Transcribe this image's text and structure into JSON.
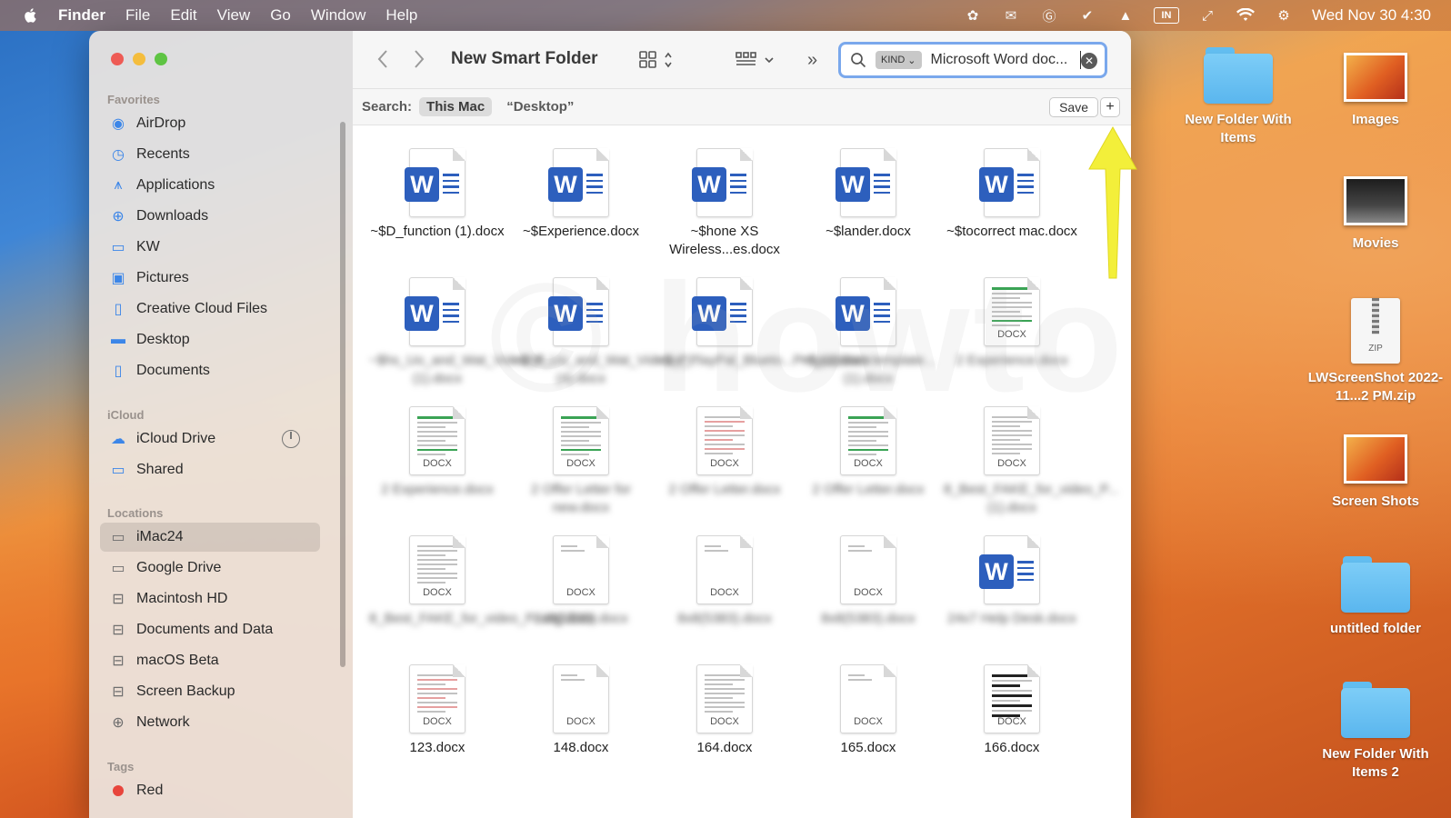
{
  "menubar": {
    "app": "Finder",
    "items": [
      "File",
      "Edit",
      "View",
      "Go",
      "Window",
      "Help"
    ],
    "input_badge": "IN",
    "clock": "Wed Nov 30  4:30"
  },
  "desktop": {
    "items": [
      {
        "label": "New Folder With Items",
        "type": "folder"
      },
      {
        "label": "Images",
        "type": "photo"
      },
      {
        "label": "Movies",
        "type": "photo-dark"
      },
      {
        "label": "LWScreenShot 2022-11...2 PM.zip",
        "type": "zip"
      },
      {
        "label": "Screen Shots",
        "type": "photo"
      },
      {
        "label": "untitled folder",
        "type": "folder"
      },
      {
        "label": "New Folder With Items 2",
        "type": "folder"
      }
    ],
    "zip_tag": "ZIP"
  },
  "sidebar": {
    "sections": {
      "favorites": "Favorites",
      "icloud": "iCloud",
      "locations": "Locations",
      "tags": "Tags"
    },
    "favorites": [
      {
        "label": "AirDrop",
        "icon": "airdrop-icon"
      },
      {
        "label": "Recents",
        "icon": "clock-icon"
      },
      {
        "label": "Applications",
        "icon": "applications-icon"
      },
      {
        "label": "Downloads",
        "icon": "download-icon"
      },
      {
        "label": "KW",
        "icon": "folder-icon"
      },
      {
        "label": "Pictures",
        "icon": "pictures-icon"
      },
      {
        "label": "Creative Cloud Files",
        "icon": "document-icon"
      },
      {
        "label": "Desktop",
        "icon": "desktop-icon"
      },
      {
        "label": "Documents",
        "icon": "document-icon"
      }
    ],
    "icloud": [
      {
        "label": "iCloud Drive",
        "icon": "cloud-icon"
      },
      {
        "label": "Shared",
        "icon": "shared-folder-icon"
      }
    ],
    "locations": [
      {
        "label": "iMac24",
        "icon": "computer-icon",
        "selected": true
      },
      {
        "label": "Google Drive",
        "icon": "folder-icon"
      },
      {
        "label": "Macintosh HD",
        "icon": "drive-icon"
      },
      {
        "label": "Documents and Data",
        "icon": "drive-icon"
      },
      {
        "label": "macOS Beta",
        "icon": "drive-icon"
      },
      {
        "label": "Screen Backup",
        "icon": "drive-icon"
      },
      {
        "label": "Network",
        "icon": "globe-icon"
      }
    ],
    "tags": [
      {
        "label": "Red",
        "color": "#e8453c"
      }
    ]
  },
  "toolbar": {
    "title": "New Smart Folder",
    "search": {
      "token": "KIND",
      "value": "Microsoft Word doc..."
    }
  },
  "scopebar": {
    "label": "Search:",
    "options": [
      "This Mac",
      "“Desktop”"
    ],
    "active": "This Mac",
    "save_label": "Save",
    "add_label": "+"
  },
  "files": [
    {
      "name": "~$D_function (1).docx",
      "icon": "word",
      "blurred": false
    },
    {
      "name": "~$Experience.docx",
      "icon": "word",
      "blurred": false
    },
    {
      "name": "~$hone XS Wireless...es.docx",
      "icon": "word",
      "blurred": false
    },
    {
      "name": "~$lander.docx",
      "icon": "word",
      "blurred": false
    },
    {
      "name": "~$tocorrect mac.docx",
      "icon": "word",
      "blurred": false
    },
    {
      "name": "~$hs_Uo_and_Wat_Video_P...(1).docx",
      "icon": "word",
      "blurred": true
    },
    {
      "name": "~$hs_Uo_and_Wat_Video_P...(4).docx",
      "icon": "word",
      "blurred": true
    },
    {
      "name": "~$ix_PlayPal_Blueto...Pm_(1).docx",
      "icon": "word",
      "blurred": true
    },
    {
      "name": "~$putdown template...(1).docx",
      "icon": "word",
      "blurred": true
    },
    {
      "name": "2 Experience.docx",
      "icon": "doc-green",
      "blurred": true
    },
    {
      "name": "2 Experience.docx",
      "icon": "doc-green",
      "blurred": true
    },
    {
      "name": "2 Offer Letter for new.docx",
      "icon": "doc-green",
      "blurred": true
    },
    {
      "name": "2 Offer Letter.docx",
      "icon": "doc-red",
      "blurred": true
    },
    {
      "name": "2 Offer Letter.docx",
      "icon": "doc-green",
      "blurred": true
    },
    {
      "name": "8_Best_FAKE_for_video_P...(1).docx",
      "icon": "doc-text",
      "blurred": true
    },
    {
      "name": "8_Best_FAKE_for_video_P...ing.docx",
      "icon": "doc-text",
      "blurred": true
    },
    {
      "name": "8x8(5338).docx",
      "icon": "doc-plain",
      "blurred": true
    },
    {
      "name": "8x8(5383).docx",
      "icon": "doc-plain",
      "blurred": true
    },
    {
      "name": "8x8(5383).docx",
      "icon": "doc-plain",
      "blurred": true
    },
    {
      "name": "24x7 Help Desk.docx",
      "icon": "word",
      "blurred": true
    },
    {
      "name": "123.docx",
      "icon": "doc-red",
      "blurred": false
    },
    {
      "name": "148.docx",
      "icon": "doc-plain",
      "blurred": false
    },
    {
      "name": "164.docx",
      "icon": "doc-text",
      "blurred": false
    },
    {
      "name": "165.docx",
      "icon": "doc-plain",
      "blurred": false
    },
    {
      "name": "166.docx",
      "icon": "doc-black",
      "blurred": false
    }
  ],
  "doc_tag": "DOCX",
  "colors": {
    "word_blue": "#2d5fbd",
    "arrow_yellow": "#f3ef3a",
    "search_focus": "#7aa8ec",
    "close": "#ee5b55",
    "minimize": "#f4bd3d",
    "zoom": "#5ec443"
  }
}
